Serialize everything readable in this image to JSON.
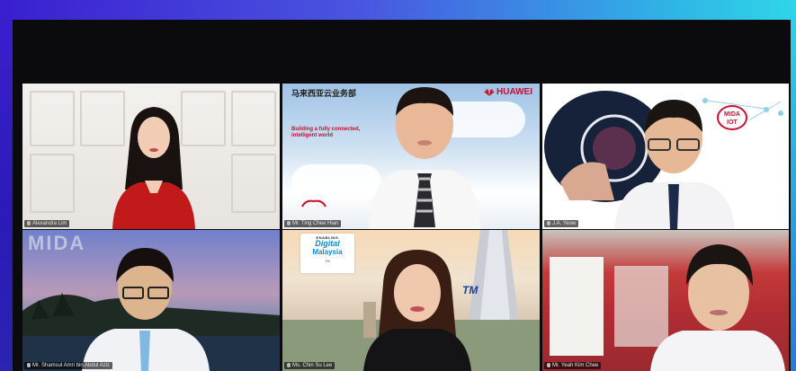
{
  "tiles": [
    {
      "id": "participant-1",
      "name_tag": "Alexandra Lim"
    },
    {
      "id": "participant-2",
      "name_tag": "Mr. Ting Chee Hian",
      "slide_heading_cn": "马来西亚云业务部",
      "slide_text": "Building a fully connected, intelligent world",
      "brand": "HUAWEI"
    },
    {
      "id": "participant-3",
      "name_tag": "J.A. Yeow",
      "badge_line1": "MIDA",
      "badge_line2": "IOT"
    },
    {
      "id": "participant-4",
      "name_tag": "Mr. Shamsul Amri bin Abdul Aziz",
      "logo_text": "MIDA"
    },
    {
      "id": "participant-5",
      "name_tag": "Ms. Chin Su Lee",
      "campaign_top": "ENABLING",
      "campaign_line1": "Digital",
      "campaign_line2": "Malaysia",
      "campaign_sub": "TM",
      "building_logo": "TM"
    },
    {
      "id": "participant-6",
      "name_tag": "Mr. Yeah Kim Chee"
    }
  ],
  "colors": {
    "frame_start": "#3a1fd0",
    "frame_end": "#2fd6e8",
    "huawei_red": "#c8102e",
    "background": "#0b0b0d"
  }
}
